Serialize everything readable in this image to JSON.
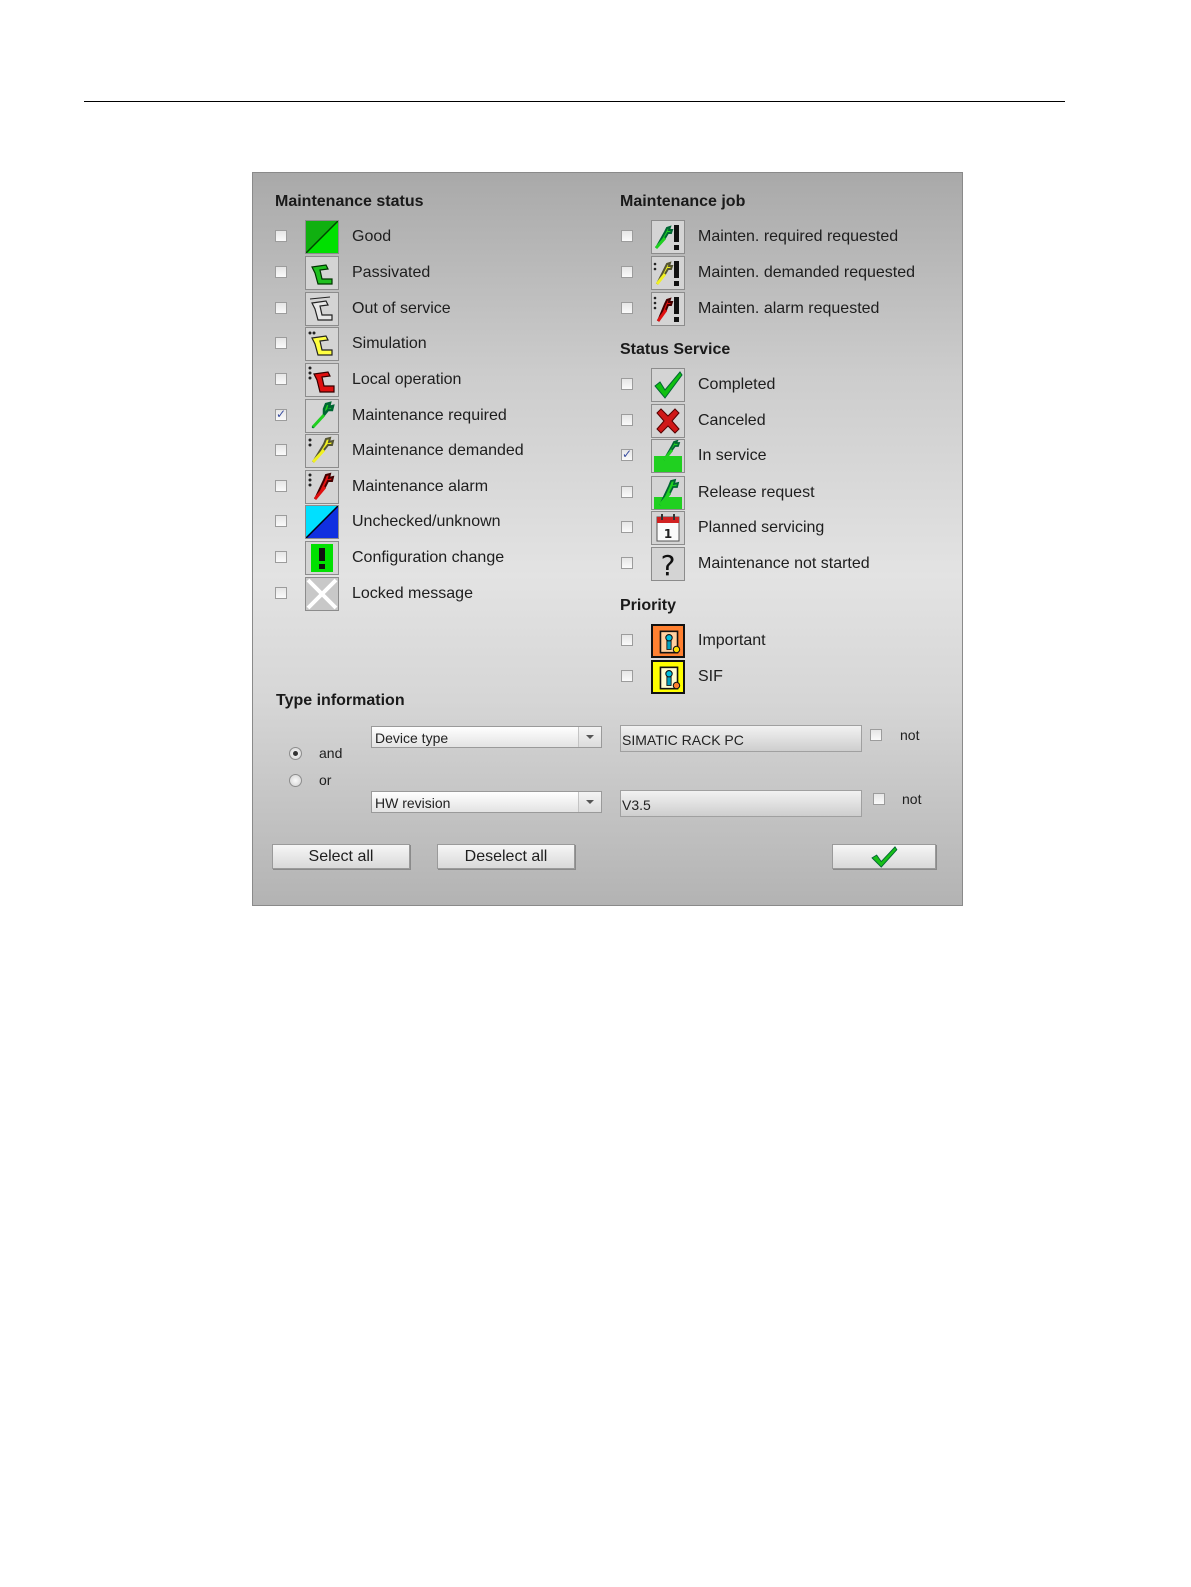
{
  "maintenance_status": {
    "title": "Maintenance status",
    "items": [
      {
        "label": "Good",
        "checked": false,
        "icon": "good-icon"
      },
      {
        "label": "Passivated",
        "checked": false,
        "icon": "passivated-hand-icon"
      },
      {
        "label": "Out of service",
        "checked": false,
        "icon": "out-of-service-hand-icon"
      },
      {
        "label": "Simulation",
        "checked": false,
        "icon": "simulation-hand-icon"
      },
      {
        "label": "Local operation",
        "checked": false,
        "icon": "local-operation-hand-icon"
      },
      {
        "label": "Maintenance required",
        "checked": true,
        "icon": "wrench-green-icon"
      },
      {
        "label": "Maintenance demanded",
        "checked": false,
        "icon": "wrench-yellow-icon"
      },
      {
        "label": "Maintenance alarm",
        "checked": false,
        "icon": "wrench-red-icon"
      },
      {
        "label": "Unchecked/unknown",
        "checked": false,
        "icon": "unknown-icon"
      },
      {
        "label": "Configuration change",
        "checked": false,
        "icon": "exclamation-icon"
      },
      {
        "label": "Locked message",
        "checked": false,
        "icon": "locked-cross-icon"
      }
    ]
  },
  "maintenance_job": {
    "title": "Maintenance job",
    "items": [
      {
        "label": "Mainten. required requested",
        "checked": false,
        "icon": "wrench-green-exclamation-icon"
      },
      {
        "label": "Mainten. demanded requested",
        "checked": false,
        "icon": "wrench-yellow-exclamation-icon"
      },
      {
        "label": "Mainten. alarm requested",
        "checked": false,
        "icon": "wrench-red-exclamation-icon"
      }
    ]
  },
  "status_service": {
    "title": "Status Service",
    "items": [
      {
        "label": "Completed",
        "checked": false,
        "icon": "checkmark-icon"
      },
      {
        "label": "Canceled",
        "checked": false,
        "icon": "red-cross-icon"
      },
      {
        "label": "In service",
        "checked": true,
        "icon": "in-service-wrench-icon"
      },
      {
        "label": "Release request",
        "checked": false,
        "icon": "release-request-icon"
      },
      {
        "label": "Planned servicing",
        "checked": false,
        "icon": "calendar-icon"
      },
      {
        "label": "Maintenance not started",
        "checked": false,
        "icon": "question-icon"
      }
    ]
  },
  "priority": {
    "title": "Priority",
    "items": [
      {
        "label": "Important",
        "checked": false,
        "icon": "important-icon"
      },
      {
        "label": "SIF",
        "checked": false,
        "icon": "sif-icon"
      }
    ]
  },
  "type_information": {
    "title": "Type information",
    "and_label": "and",
    "or_label": "or",
    "selected_logic": "and",
    "filter1": {
      "field": "Device type",
      "value": "SIMATIC RACK PC",
      "not_label": "not",
      "not_checked": false
    },
    "filter2": {
      "field": "HW revision",
      "value": "V3.5",
      "not_label": "not",
      "not_checked": false
    }
  },
  "buttons": {
    "select_all": "Select all",
    "deselect_all": "Deselect all",
    "ok_icon": "checkmark-icon"
  },
  "colors": {
    "good_green": "#00d000",
    "unknown_cyan": "#00e0ff",
    "unknown_blue": "#1030e0",
    "simulation_yellow": "#ffff40",
    "alarm_red": "#e00000",
    "important_orange": "#ff8030",
    "sif_yellow": "#ffff00"
  }
}
